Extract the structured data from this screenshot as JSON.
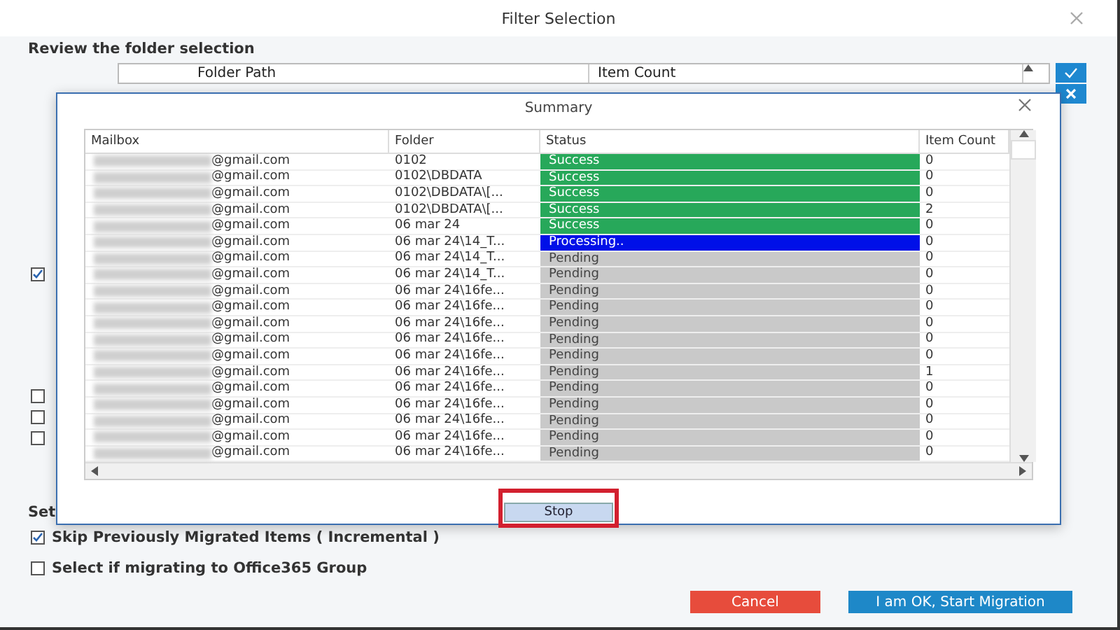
{
  "window": {
    "title": "Filter Selection"
  },
  "folder_selection": {
    "heading": "Review the folder selection",
    "columns": [
      "Folder Path",
      "Item Count"
    ]
  },
  "side_options": [
    {
      "checked": true
    },
    {
      "checked": false
    },
    {
      "checked": false
    },
    {
      "checked": false
    }
  ],
  "settings": {
    "heading": "Set",
    "options": [
      {
        "label": "Skip Previously Migrated Items ( Incremental )",
        "checked": true
      },
      {
        "label": "Select if migrating to Office365 Group",
        "checked": false
      }
    ]
  },
  "buttons": [
    {
      "label": "Cancel",
      "kind": "cancel"
    },
    {
      "label": "I am OK, Start Migration",
      "kind": "primary"
    }
  ],
  "summary": {
    "title": "Summary",
    "columns": [
      "Mailbox",
      "Folder",
      "Status",
      "Item Count"
    ],
    "rows": [
      {
        "mailbox": "@gmail.com",
        "folder": "0102",
        "status": "Success",
        "kind": "success",
        "item_count": "0"
      },
      {
        "mailbox": "@gmail.com",
        "folder": "0102\\DBDATA",
        "status": "Success",
        "kind": "success",
        "item_count": "0"
      },
      {
        "mailbox": "@gmail.com",
        "folder": "0102\\DBDATA\\[...",
        "status": "Success",
        "kind": "success",
        "item_count": "0"
      },
      {
        "mailbox": "@gmail.com",
        "folder": "0102\\DBDATA\\[...",
        "status": "Success",
        "kind": "success",
        "item_count": "2"
      },
      {
        "mailbox": "@gmail.com",
        "folder": "06 mar 24",
        "status": "Success",
        "kind": "success",
        "item_count": "0"
      },
      {
        "mailbox": "@gmail.com",
        "folder": "06 mar 24\\14_T...",
        "status": "Processing..",
        "kind": "processing",
        "item_count": "0"
      },
      {
        "mailbox": "@gmail.com",
        "folder": "06 mar 24\\14_T...",
        "status": "Pending",
        "kind": "pending",
        "item_count": "0"
      },
      {
        "mailbox": "@gmail.com",
        "folder": "06 mar 24\\14_T...",
        "status": "Pending",
        "kind": "pending",
        "item_count": "0"
      },
      {
        "mailbox": "@gmail.com",
        "folder": "06 mar 24\\16fe...",
        "status": "Pending",
        "kind": "pending",
        "item_count": "0"
      },
      {
        "mailbox": "@gmail.com",
        "folder": "06 mar 24\\16fe...",
        "status": "Pending",
        "kind": "pending",
        "item_count": "0"
      },
      {
        "mailbox": "@gmail.com",
        "folder": "06 mar 24\\16fe...",
        "status": "Pending",
        "kind": "pending",
        "item_count": "0"
      },
      {
        "mailbox": "@gmail.com",
        "folder": "06 mar 24\\16fe...",
        "status": "Pending",
        "kind": "pending",
        "item_count": "0"
      },
      {
        "mailbox": "@gmail.com",
        "folder": "06 mar 24\\16fe...",
        "status": "Pending",
        "kind": "pending",
        "item_count": "0"
      },
      {
        "mailbox": "@gmail.com",
        "folder": "06 mar 24\\16fe...",
        "status": "Pending",
        "kind": "pending",
        "item_count": "1"
      },
      {
        "mailbox": "@gmail.com",
        "folder": "06 mar 24\\16fe...",
        "status": "Pending",
        "kind": "pending",
        "item_count": "0"
      },
      {
        "mailbox": "@gmail.com",
        "folder": "06 mar 24\\16fe...",
        "status": "Pending",
        "kind": "pending",
        "item_count": "0"
      },
      {
        "mailbox": "@gmail.com",
        "folder": "06 mar 24\\16fe...",
        "status": "Pending",
        "kind": "pending",
        "item_count": "0"
      },
      {
        "mailbox": "@gmail.com",
        "folder": "06 mar 24\\16fe...",
        "status": "Pending",
        "kind": "pending",
        "item_count": "0"
      },
      {
        "mailbox": "@gmail.com",
        "folder": "06 mar 24\\16fe...",
        "status": "Pending",
        "kind": "pending",
        "item_count": "0"
      }
    ],
    "button": "Stop"
  }
}
